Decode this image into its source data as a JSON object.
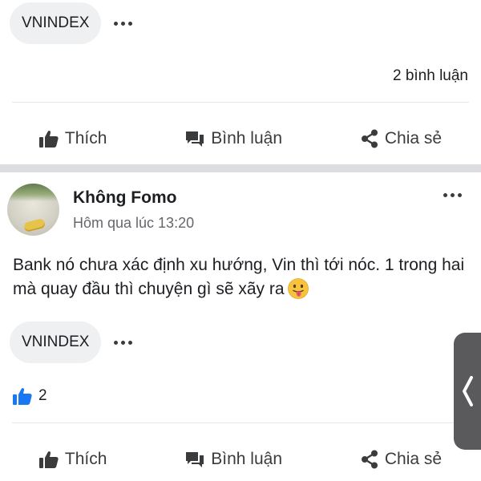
{
  "post_previous": {
    "tag": "VNINDEX",
    "comment_count": "2 bình luận"
  },
  "actions": {
    "like": "Thích",
    "comment": "Bình luận",
    "share": "Chia sẻ"
  },
  "post": {
    "author": "Không Fomo",
    "time": "Hôm qua lúc 13:20",
    "text": "Bank nó chưa xác định xu hướng, Vin thì tới nóc. 1 trong hai mà quay đầu thì chuyện gì sẽ xãy ra",
    "emoji": "tongue-out-emoji",
    "tag": "VNINDEX",
    "like_count": "2"
  },
  "colors": {
    "like_blue": "#1877f2",
    "text_dark": "#1c1e21",
    "text_muted": "#65676b",
    "pill_bg": "#eff0f2",
    "side_tab": "#5a5a5c"
  }
}
